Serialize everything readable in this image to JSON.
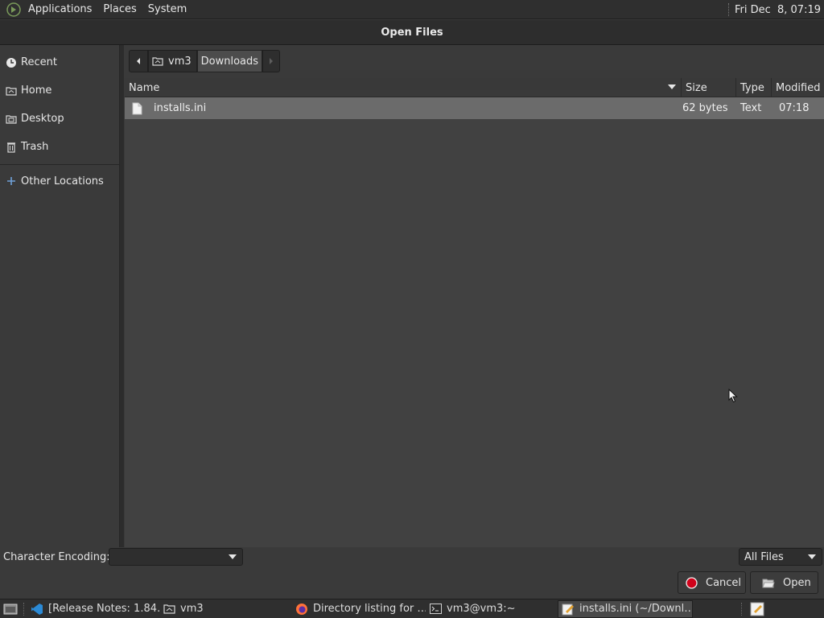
{
  "top_panel": {
    "menus": [
      "Applications",
      "Places",
      "System"
    ],
    "clock": "Fri Dec  8, 07:19"
  },
  "dialog": {
    "title": "Open Files"
  },
  "sidebar": {
    "items": [
      {
        "label": "Recent",
        "icon": "recent-icon"
      },
      {
        "label": "Home",
        "icon": "home-folder-icon"
      },
      {
        "label": "Desktop",
        "icon": "desktop-folder-icon"
      },
      {
        "label": "Trash",
        "icon": "trash-icon"
      }
    ],
    "other": {
      "label": "Other Locations",
      "icon": "plus-icon"
    }
  },
  "pathbar": {
    "segments": [
      "vm3",
      "Downloads"
    ]
  },
  "filelist": {
    "columns": [
      "Name",
      "Size",
      "Type",
      "Modified"
    ],
    "rows": [
      {
        "name": "installs.ini",
        "size": "62 bytes",
        "type": "Text",
        "modified": "07:18"
      }
    ]
  },
  "bottom": {
    "encoding_label": "Character Encoding:",
    "encoding_value": "",
    "filter_value": "All Files",
    "cancel_label": "Cancel",
    "open_label": "Open"
  },
  "taskbar": {
    "tasks": [
      {
        "label": "[Release Notes: 1.84…",
        "icon": "vscode-icon"
      },
      {
        "label": "vm3",
        "icon": "folder-icon"
      },
      {
        "label": "Directory listing for …",
        "icon": "firefox-icon"
      },
      {
        "label": "vm3@vm3:~",
        "icon": "terminal-icon"
      },
      {
        "label": "installs.ini (~/Downl…",
        "icon": "text-editor-icon",
        "active": true
      }
    ]
  },
  "colors": {
    "selection": "#6b6b6b",
    "cancel_red": "#d0021b"
  }
}
